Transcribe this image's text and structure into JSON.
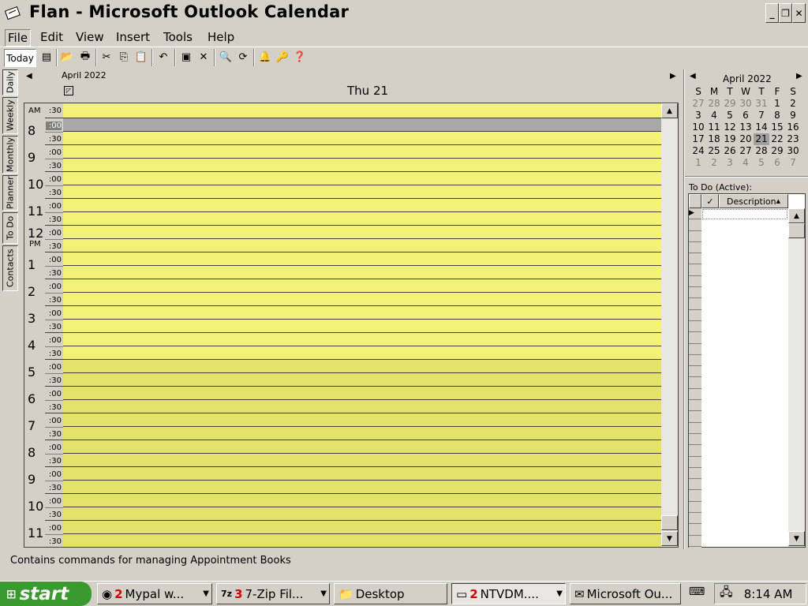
{
  "window": {
    "title": "Flan - Microsoft Outlook Calendar"
  },
  "menu": [
    "File",
    "Edit",
    "View",
    "Insert",
    "Tools",
    "Help"
  ],
  "toolbar": {
    "today_label": "Today"
  },
  "side_tabs": [
    "Daily",
    "Weekly",
    "Monthly",
    "Planner",
    "To Do",
    "Contacts"
  ],
  "day_view": {
    "month_label": "April 2022",
    "day_title": "Thu 21",
    "am_label": "AM",
    "pm_label": "PM",
    "hours": [
      {
        "h": "8",
        "m1": ":00",
        "m2": ":30"
      },
      {
        "h": "9",
        "m1": ":00",
        "m2": ":30"
      },
      {
        "h": "10",
        "m1": ":00",
        "m2": ":30"
      },
      {
        "h": "11",
        "m1": ":00",
        "m2": ":30"
      },
      {
        "h": "12",
        "m1": ":00",
        "m2": ":30"
      },
      {
        "h": "1",
        "m1": ":00",
        "m2": ":30"
      },
      {
        "h": "2",
        "m1": ":00",
        "m2": ":30"
      },
      {
        "h": "3",
        "m1": ":00",
        "m2": ":30"
      },
      {
        "h": "4",
        "m1": ":00",
        "m2": ":30"
      },
      {
        "h": "5",
        "m1": ":00",
        "m2": ":30"
      },
      {
        "h": "6",
        "m1": ":00",
        "m2": ":30"
      },
      {
        "h": "7",
        "m1": ":00",
        "m2": ":30"
      },
      {
        "h": "8",
        "m1": ":00",
        "m2": ":30"
      },
      {
        "h": "9",
        "m1": ":00",
        "m2": ":30"
      },
      {
        "h": "10",
        "m1": ":00",
        "m2": ":30"
      },
      {
        "h": "11",
        "m1": ":00",
        "m2": ":30"
      }
    ],
    "first_partial": ":30"
  },
  "mini_calendar": {
    "month": "April 2022",
    "weekdays": [
      "S",
      "M",
      "T",
      "W",
      "T",
      "F",
      "S"
    ],
    "weeks": [
      [
        "27",
        "28",
        "29",
        "30",
        "31",
        "1",
        "2"
      ],
      [
        "3",
        "4",
        "5",
        "6",
        "7",
        "8",
        "9"
      ],
      [
        "10",
        "11",
        "12",
        "13",
        "14",
        "15",
        "16"
      ],
      [
        "17",
        "18",
        "19",
        "20",
        "21",
        "22",
        "23"
      ],
      [
        "24",
        "25",
        "26",
        "27",
        "28",
        "29",
        "30"
      ],
      [
        "1",
        "2",
        "3",
        "4",
        "5",
        "6",
        "7"
      ]
    ],
    "selected": "21"
  },
  "todo": {
    "label": "To Do (Active):",
    "check_header": "✓",
    "description_header": "Description"
  },
  "status": {
    "text": "Contains commands for managing Appointment Books"
  },
  "taskbar": {
    "start": "start",
    "tasks": [
      {
        "count": "2",
        "label": "Mypal w..."
      },
      {
        "count": "3",
        "label": "7-Zip Fil..."
      },
      {
        "count": "",
        "label": "Desktop"
      },
      {
        "count": "2",
        "label": "NTVDM...."
      },
      {
        "count": "",
        "label": "Microsoft Ou..."
      }
    ],
    "clock": "8:14 AM"
  }
}
